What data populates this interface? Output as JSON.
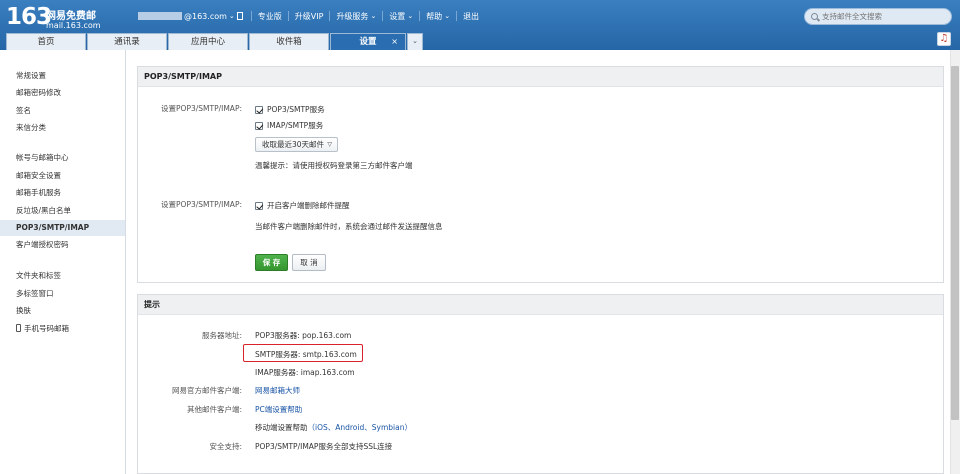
{
  "logo": {
    "number": "163",
    "name": "网易免费邮",
    "domain": "mail.163.com"
  },
  "topnav": {
    "account_suffix": "@163.com",
    "items": [
      "专业版",
      "升级VIP",
      "升级服务",
      "设置",
      "帮助",
      "退出"
    ]
  },
  "search": {
    "placeholder": "支持邮件全文搜索"
  },
  "tabs": {
    "items": [
      "首页",
      "通讯录",
      "应用中心",
      "收件箱"
    ],
    "active": "设置",
    "close": "×",
    "more": "⌄"
  },
  "sidebar": {
    "items": [
      "常规设置",
      "邮箱密码修改",
      "签名",
      "来信分类",
      "帐号与邮箱中心",
      "邮箱安全设置",
      "邮箱手机服务",
      "反垃圾/黑白名单",
      "POP3/SMTP/IMAP",
      "客户端授权密码",
      "文件夹和标签",
      "多标签窗口",
      "换肤",
      "手机号码邮箱"
    ],
    "active_index": 8
  },
  "pop_panel": {
    "title": "POP3/SMTP/IMAP",
    "section1_label": "设置POP3/SMTP/IMAP:",
    "checkbox_pop3": "POP3/SMTP服务",
    "checkbox_imap": "IMAP/SMTP服务",
    "pop3_checked": true,
    "imap_checked": true,
    "dropdown_value": "收取最近30天邮件",
    "tip": "温馨提示：请使用授权码登录第三方邮件客户端",
    "section2_label": "设置POP3/SMTP/IMAP:",
    "checkbox_delete": "开启客户端删除邮件提醒",
    "delete_checked": true,
    "delete_note": "当邮件客户端删除邮件时，系统会通过邮件发送提醒信息",
    "save": "保 存",
    "cancel": "取 消"
  },
  "tips_panel": {
    "title": "提示",
    "server_label": "服务器地址:",
    "pop3_server": "POP3服务器: pop.163.com",
    "smtp_server": "SMTP服务器: smtp.163.com",
    "imap_server": "IMAP服务器: imap.163.com",
    "official_label": "网易官方邮件客户端:",
    "official_link": "网易邮箱大师",
    "other_label": "其他邮件客户端:",
    "other_link": "PC端设置帮助",
    "mobile_text": "移动端设置帮助",
    "mobile_links": "（iOS、Android、Symbian）",
    "ssl_label": "安全支持:",
    "ssl_text": "POP3/SMTP/IMAP服务全部支持SSL连接"
  },
  "colors": {
    "header": "#2a6db0",
    "save_button": "#3fa23a",
    "highlight": "#d9232a",
    "link": "#1a55a5"
  }
}
